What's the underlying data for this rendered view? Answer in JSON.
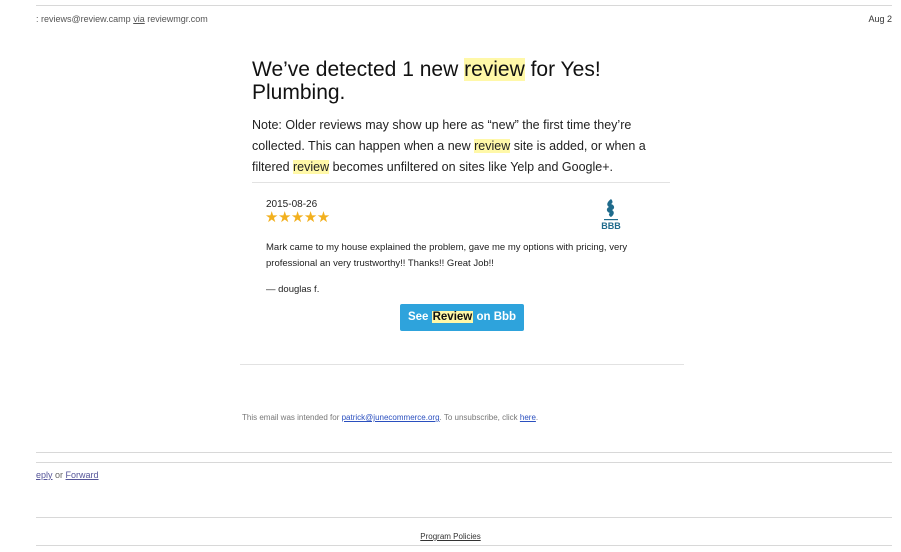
{
  "header": {
    "sender_email": "reviews@review.camp",
    "via_label": "via",
    "via_domain": "reviewmgr.com",
    "date": "Aug 2"
  },
  "email": {
    "headline_prefix": "We’ve detected 1 new ",
    "headline_highlight": "review",
    "headline_suffix": " for Yes! Plumbing.",
    "note_part1": "Note: Older reviews may show up here as “new” the first time they’re collected. This can happen when a new ",
    "note_highlight1": "review",
    "note_part2": " site is added, or when a filtered ",
    "note_highlight2": "review",
    "note_part3": " becomes unfiltered on sites like Yelp and Google+."
  },
  "review": {
    "date": "2015-08-26",
    "rating": 5,
    "stars": "★★★★★",
    "source_logo": "bbb-logo",
    "text": "Mark came to my house explained the problem, gave me my options with pricing, very professional an very trustworthy!! Thanks!! Great Job!!",
    "author": "— douglas f."
  },
  "button": {
    "prefix": "See ",
    "highlight": "Review",
    "suffix": " on Bbb",
    "color": "#2ea3dc"
  },
  "footer": {
    "intended_prefix": "This email was intended for ",
    "intended_email": "patrick@junecommerce.org",
    "unsubscribe_prefix": ". To unsubscribe, click ",
    "unsubscribe_link": "here",
    "unsubscribe_suffix": "."
  },
  "actions": {
    "reply": "eply",
    "or": " or ",
    "forward": "Forward"
  },
  "policies": {
    "label": "Program Policies"
  },
  "colors": {
    "highlight": "#fff8a8",
    "star": "#f2b01e",
    "bbb_blue": "#1f6b8c"
  }
}
